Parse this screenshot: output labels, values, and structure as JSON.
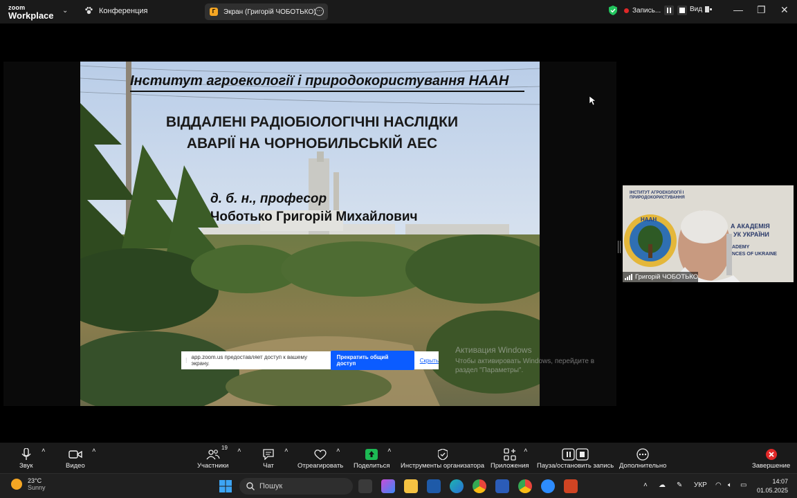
{
  "topbar": {
    "logo_line1": "zoom",
    "logo_line2": "Workplace",
    "conference_label": "Конференция",
    "screen_label": "Экран (Григорій ЧОБОТЬКО)",
    "recording_label": "Запись...",
    "view_label": "Вид"
  },
  "slide": {
    "institute": "Інститут агроекології і природокористування НААН",
    "title_line1": "ВІДДАЛЕНІ РАДІОБІОЛОГІЧНІ НАСЛІДКИ",
    "title_line2": "АВАРІЇ НА ЧОРНОБИЛЬСЬКІЙ АЕС",
    "author_degree": "д. б. н., професор",
    "author_name": "Чоботько Григорій Михайлович"
  },
  "share_bar": {
    "message": "app.zoom.us предоставляет доступ к вашему экрану.",
    "stop_label": "Прекратить общий доступ",
    "hide_label": "Скрыть"
  },
  "activation": {
    "line1": "Активация Windows",
    "line2": "Чтобы активировать Windows, перейдите в раздел \"Параметры\"."
  },
  "thumbnail": {
    "participant_name": "Григорій ЧОБОТЬКО",
    "bg_text1": "ІНСТИТУТ АГРОЕКОЛОГІЇ І ПРИРОДОКОРИСТУВАННЯ",
    "bg_text2": "НААН",
    "bg_text3": "А АКАДЕМІЯ",
    "bg_text4": "УК УКРАЇНИ",
    "bg_text5": "ADEMY",
    "bg_text6": "NCES OF UKRAINE"
  },
  "toolbar": {
    "audio": "Звук",
    "video": "Видео",
    "participants": "Участники",
    "participants_count": "19",
    "chat": "Чат",
    "react": "Отреагировать",
    "share": "Поделиться",
    "host_tools": "Инструменты организатора",
    "apps": "Приложения",
    "record": "Пауза/остановить запись",
    "more": "Дополнительно",
    "end": "Завершение"
  },
  "taskbar": {
    "temperature": "23°C",
    "weather": "Sunny",
    "search_placeholder": "Пошук",
    "language": "УКР",
    "time": "14:07",
    "date": "01.05.2025"
  },
  "colors": {
    "accent_blue": "#0b5cff",
    "record_red": "#e02828",
    "share_green": "#1db954",
    "end_red": "#e02828"
  }
}
